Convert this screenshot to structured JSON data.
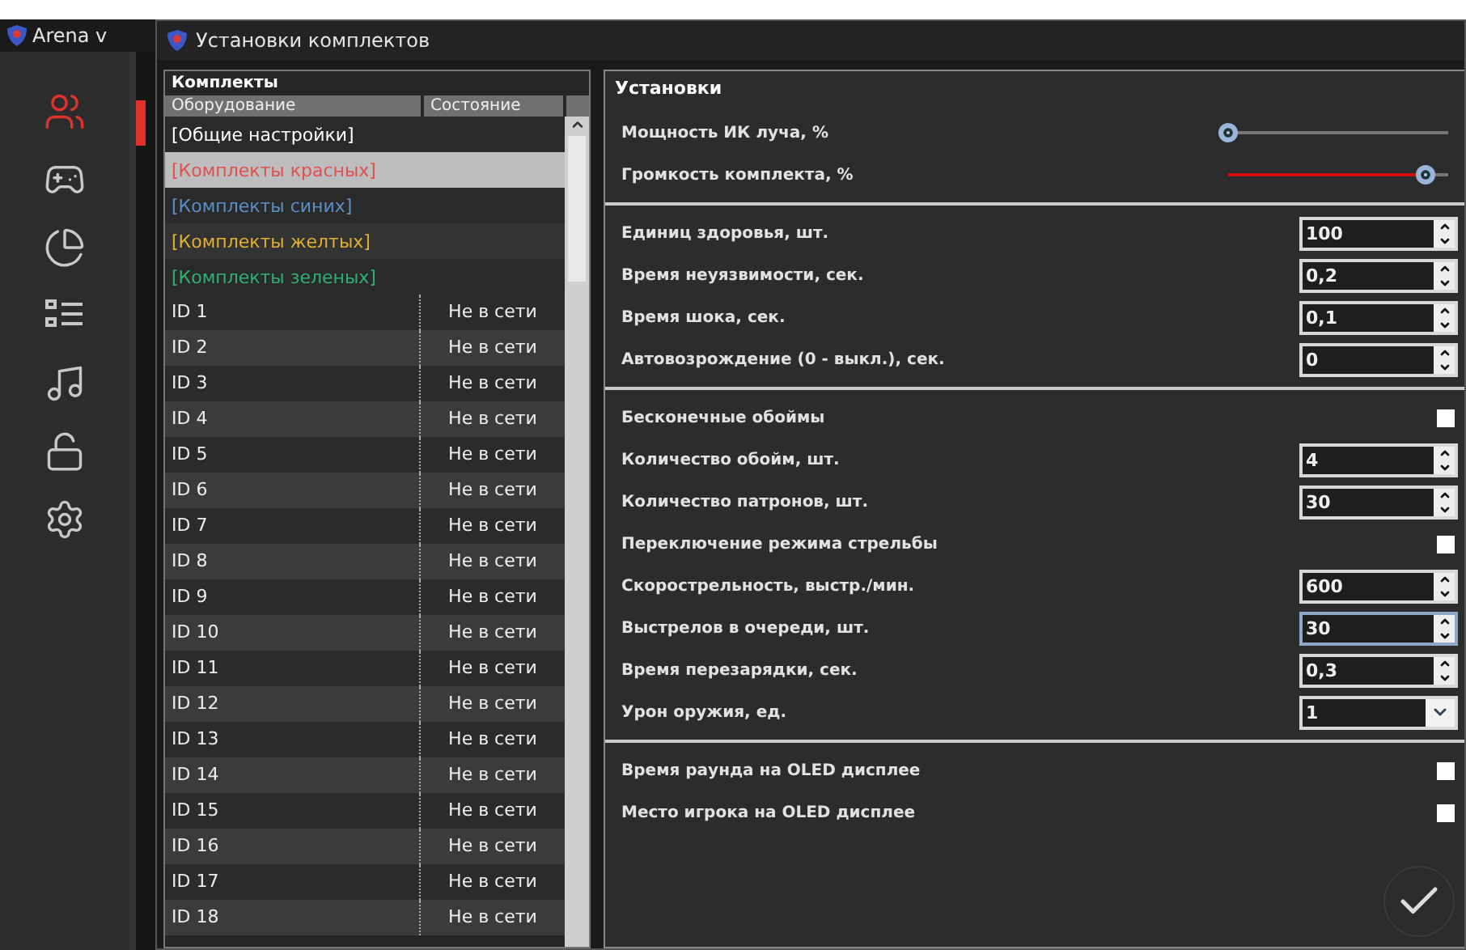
{
  "background_window": {
    "title": "Arena v"
  },
  "nav": [
    {
      "selected": true
    },
    {
      "selected": false
    },
    {
      "selected": false
    },
    {
      "selected": false
    },
    {
      "selected": false
    },
    {
      "selected": false
    },
    {
      "selected": false
    }
  ],
  "dialog": {
    "title": "Установки комплектов"
  },
  "kits": {
    "title": "Комплекты",
    "columns": [
      "Оборудование",
      "Состояние"
    ],
    "groups": [
      {
        "label": "[Общие настройки]",
        "color": "#ffffff",
        "selected": false
      },
      {
        "label": "[Комплекты красных]",
        "color": "#e05050",
        "selected": true
      },
      {
        "label": "[Комплекты синих]",
        "color": "#5b8fc7",
        "selected": false
      },
      {
        "label": "[Комплекты желтых]",
        "color": "#e0b030",
        "selected": false
      },
      {
        "label": "[Комплекты зеленых]",
        "color": "#30b070",
        "selected": false
      }
    ],
    "rows": [
      {
        "id": "ID 1",
        "status": "Не в сети"
      },
      {
        "id": "ID 2",
        "status": "Не в сети"
      },
      {
        "id": "ID 3",
        "status": "Не в сети"
      },
      {
        "id": "ID 4",
        "status": "Не в сети"
      },
      {
        "id": "ID 5",
        "status": "Не в сети"
      },
      {
        "id": "ID 6",
        "status": "Не в сети"
      },
      {
        "id": "ID 7",
        "status": "Не в сети"
      },
      {
        "id": "ID 8",
        "status": "Не в сети"
      },
      {
        "id": "ID 9",
        "status": "Не в сети"
      },
      {
        "id": "ID 10",
        "status": "Не в сети"
      },
      {
        "id": "ID 11",
        "status": "Не в сети"
      },
      {
        "id": "ID 12",
        "status": "Не в сети"
      },
      {
        "id": "ID 13",
        "status": "Не в сети"
      },
      {
        "id": "ID 14",
        "status": "Не в сети"
      },
      {
        "id": "ID 15",
        "status": "Не в сети"
      },
      {
        "id": "ID 16",
        "status": "Не в сети"
      },
      {
        "id": "ID 17",
        "status": "Не в сети"
      },
      {
        "id": "ID 18",
        "status": "Не в сети"
      }
    ]
  },
  "settings": {
    "title": "Установки",
    "sections": [
      [
        {
          "kind": "slider",
          "label": "Мощность ИК луча, %",
          "level": 0
        },
        {
          "kind": "slider",
          "label": "Громкость комплекта, %",
          "level": 0.9
        }
      ],
      [
        {
          "kind": "spin",
          "label": "Единиц здоровья, шт.",
          "value": "100",
          "focused": false
        },
        {
          "kind": "spin",
          "label": "Время неуязвимости, сек.",
          "value": "0,2",
          "focused": false
        },
        {
          "kind": "spin",
          "label": "Время шока, сек.",
          "value": "0,1",
          "focused": false
        },
        {
          "kind": "spin",
          "label": "Автовозрождение (0 - выкл.), сек.",
          "value": "0",
          "focused": false
        }
      ],
      [
        {
          "kind": "checkbox",
          "label": "Бесконечные обоймы",
          "checked": false
        },
        {
          "kind": "spin",
          "label": "Количество обойм, шт.",
          "value": "4",
          "focused": false
        },
        {
          "kind": "spin",
          "label": "Количество патронов, шт.",
          "value": "30",
          "focused": false
        },
        {
          "kind": "checkbox",
          "label": "Переключение режима стрельбы",
          "checked": false
        },
        {
          "kind": "spin",
          "label": "Скорострельность, выстр./мин.",
          "value": "600",
          "focused": false
        },
        {
          "kind": "spin",
          "label": "Выстрелов в очереди, шт.",
          "value": "30",
          "focused": true
        },
        {
          "kind": "spin",
          "label": "Время перезарядки, сек.",
          "value": "0,3",
          "focused": false
        },
        {
          "kind": "dropdown",
          "label": "Урон оружия, ед.",
          "value": "1"
        }
      ],
      [
        {
          "kind": "checkbox",
          "label": "Время раунда на OLED дисплее",
          "checked": false
        },
        {
          "kind": "checkbox",
          "label": "Место игрока на OLED дисплее",
          "checked": false
        }
      ]
    ]
  }
}
